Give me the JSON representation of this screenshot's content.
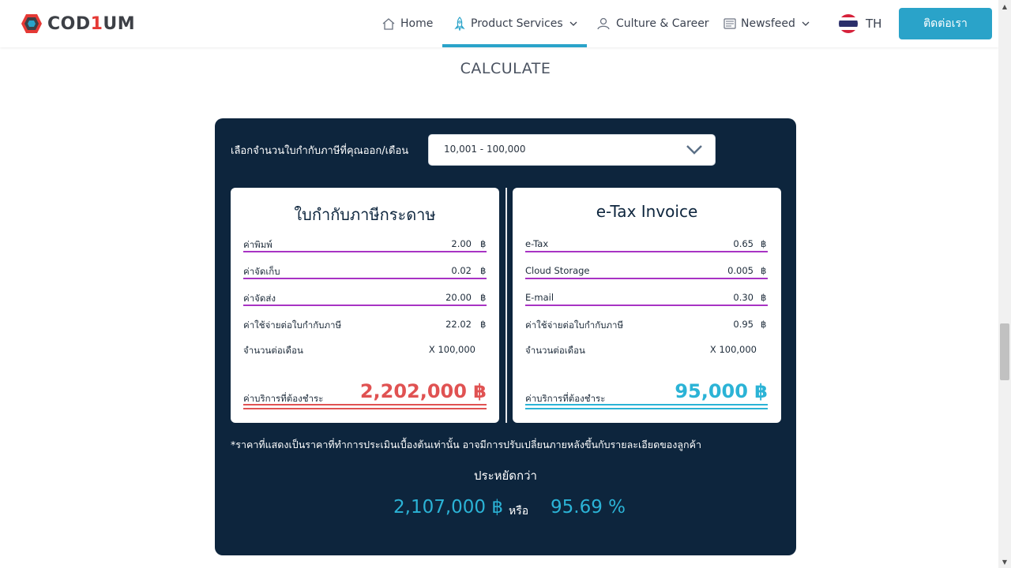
{
  "brand": {
    "logo_text_a": "COD",
    "logo_text_accent": "1",
    "logo_text_b": "UM"
  },
  "nav": {
    "home": "Home",
    "product_services": "Product Services",
    "culture_career": "Culture & Career",
    "newsfeed": "Newsfeed",
    "lang": "TH",
    "contact": "ติดต่อเรา"
  },
  "colors": {
    "accent": "#2aa3c9",
    "panel": "#0d253d",
    "paper_total": "#e05252",
    "etax_total": "#2bb3d6",
    "row_line": "#a833c4"
  },
  "page": {
    "heading": "CALCULATE"
  },
  "calculator": {
    "select_label": "เลือกจำนวนใบกำกับภาษีที่คุณออก/เดือน",
    "select_value": "10,001 - 100,000",
    "paper": {
      "title": "ใบกำกับภาษีกระดาษ",
      "rows": [
        {
          "label": "ค่าพิมพ์",
          "value": "2.00",
          "unit": "฿"
        },
        {
          "label": "ค่าจัดเก็บ",
          "value": "0.02",
          "unit": "฿"
        },
        {
          "label": "ค่าจัดส่ง",
          "value": "20.00",
          "unit": "฿"
        },
        {
          "label": "ค่าใช้จ่ายต่อใบกำกับภาษี",
          "value": "22.02",
          "unit": "฿"
        }
      ],
      "monthly_label": "จำนวนต่อเดือน",
      "monthly_value": "X 100,000",
      "total_label": "ค่าบริการที่ต้องชำระ",
      "total_value": "2,202,000  ฿"
    },
    "etax": {
      "title": "e-Tax Invoice",
      "rows": [
        {
          "label": "e-Tax",
          "value": "0.65",
          "unit": "฿"
        },
        {
          "label": "Cloud Storage",
          "value": "0.005",
          "unit": "฿"
        },
        {
          "label": "E-mail",
          "value": "0.30",
          "unit": "฿"
        },
        {
          "label": "ค่าใช้จ่ายต่อใบกำกับภาษี",
          "value": "0.95",
          "unit": "฿"
        }
      ],
      "monthly_label": "จำนวนต่อเดือน",
      "monthly_value": "X 100,000",
      "total_label": "ค่าบริการที่ต้องชำระ",
      "total_value": "95,000 ฿"
    },
    "note": "*ราคาที่แสดงเป็นราคาที่ทำการประเมินเบื้องต้นเท่านั้น อาจมีการปรับเปลี่ยนภายหลังขึ้นกับรายละเอียดของลูกค้า",
    "savings_title": "ประหยัดกว่า",
    "savings_amount": "2,107,000 ฿",
    "savings_or": "หรือ",
    "savings_percent": "95.69 %"
  }
}
